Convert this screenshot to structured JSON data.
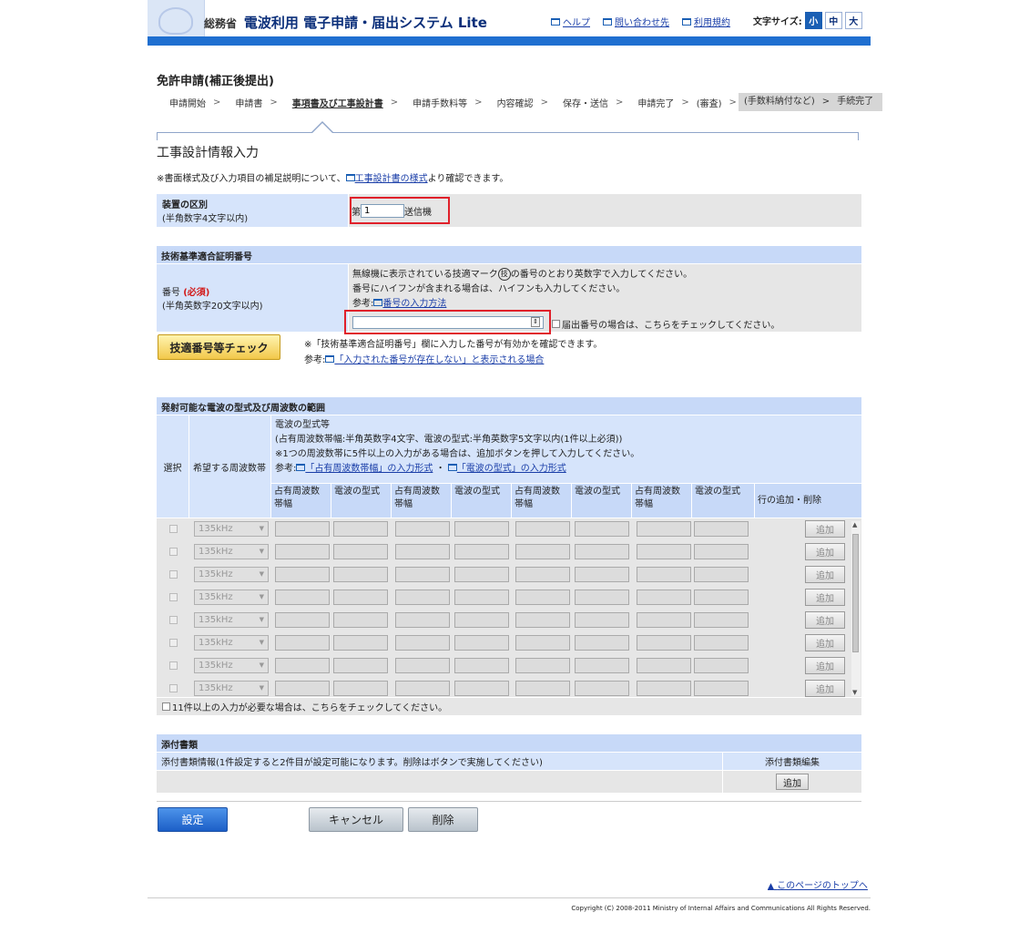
{
  "header": {
    "ministry": "総務省",
    "system_name": "電波利用 電子申請・届出システム Lite",
    "links": [
      "ヘルプ",
      "問い合わせ先",
      "利用規約"
    ],
    "font_size_label": "文字サイズ:",
    "font_sizes": [
      "小",
      "中",
      "大"
    ]
  },
  "page": {
    "title": "免許申請(補正後提出)",
    "section_title": "工事設計情報入力",
    "note_prefix": "※書面様式及び入力項目の補足説明について、",
    "note_link": "工事設計書の様式",
    "note_suffix": "より確認できます。"
  },
  "steps": [
    "申請開始",
    "申請書",
    "事項書及び工事設計書",
    "申請手数料等",
    "内容確認",
    "保存・送信",
    "申請完了",
    "(審査)",
    "(手数料納付など)",
    "手続完了"
  ],
  "device": {
    "label": "装置の区別",
    "sub": "(半角数字4文字以内)",
    "prefix": "第",
    "value": "1",
    "suffix": "送信機"
  },
  "cert": {
    "header": "技術基準適合証明番号",
    "label": "番号",
    "required": "(必須)",
    "sub": "(半角英数字20文字以内)",
    "desc1": "無線機に表示されている技適マーク",
    "desc1b": "の番号のとおり英数字で入力してください。",
    "desc2": "番号にハイフンが含まれる場合は、ハイフンも入力してください。",
    "ref_label": "参考:",
    "ref_link": "番号の入力方法",
    "value": "",
    "chk_label": "届出番号の場合は、こちらをチェックしてください。",
    "check_button": "技適番号等チェック",
    "check_note": "※「技術基準適合証明番号」欄に入力した番号が有効かを確認できます。",
    "ref2_label": "参考:",
    "ref2_link": "「入力された番号が存在しない」と表示される場合"
  },
  "freq": {
    "header": "発射可能な電波の型式及び周波数の範囲",
    "col_select": "選択",
    "col_freq": "希望する周波数帯",
    "desc_title": "電波の型式等",
    "desc1": "(占有周波数帯幅:半角英数字4文字、電波の型式:半角英数字5文字以内(1件以上必須))",
    "desc2": "※1つの周波数帯に5件以上の入力がある場合は、追加ボタンを押して入力してください。",
    "ref_label": "参考:",
    "ref_link1": "「占有周波数帯幅」の入力形式",
    "ref_sep": "・",
    "ref_link2": "「電波の型式」の入力形式",
    "sub_cols": [
      "占有周波数帯幅",
      "電波の型式",
      "占有周波数帯幅",
      "電波の型式",
      "占有周波数帯幅",
      "電波の型式",
      "占有周波数帯幅",
      "電波の型式"
    ],
    "col_action": "行の追加・削除",
    "row_select_value": "135kHz",
    "add_label": "追加",
    "rows": 8,
    "over_label": "11件以上の入力が必要な場合は、こちらをチェックしてください。"
  },
  "attach": {
    "header": "添付書類",
    "info": "添付書類情報(1件設定すると2件目が設定可能になります。削除はボタンで実施してください)",
    "edit_header": "添付書類編集",
    "add_label": "追加"
  },
  "actions": {
    "set": "設定",
    "cancel": "キャンセル",
    "delete": "削除"
  },
  "footer": {
    "top_link": "このページのトップへ",
    "copyright": "Copyright (C) 2008-2011 Ministry of Internal Affairs and Communications All Rights Reserved."
  }
}
